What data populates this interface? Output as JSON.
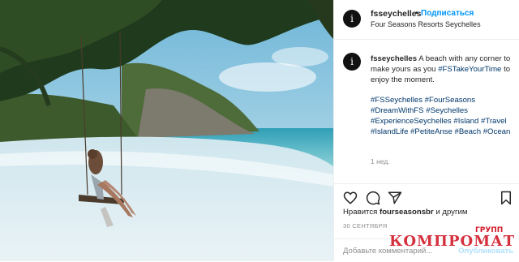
{
  "post": {
    "username": "fsseychelles",
    "separator": "•",
    "follow_label": "Подписаться",
    "location": "Four Seasons Resorts Seychelles",
    "avatar_letter": "i",
    "image_alt": "Woman on swing on a white sand beach with turquoise sea"
  },
  "caption": {
    "username": "fsseychelles",
    "text_1": " A beach with any corner to make yours as you ",
    "tag_1": "#FSTakeYourTime",
    "text_2": " to enjoy the moment.",
    "hashtags": [
      "#FSSeychelles",
      "#FourSeasons",
      "#DreamWithFS",
      "#Seychelles",
      "#ExperienceSeychelles",
      "#Island",
      "#Travel",
      "#IslandLife",
      "#PetiteAnse",
      "#Beach",
      "#Ocean"
    ],
    "time_ago": "1 нед."
  },
  "actions": {
    "icons": [
      "heart-icon",
      "comment-icon",
      "share-icon",
      "bookmark-icon"
    ]
  },
  "likes": {
    "prefix": "Нравится ",
    "user": "fourseasonsbr",
    "suffix": " и другим"
  },
  "date": "30 СЕНТЯБРЯ",
  "comment": {
    "placeholder": "Добавьте комментарий...",
    "publish_label": "Опубликовать"
  },
  "watermark": {
    "main": "КОМПРОМАТ",
    "sup": "ГРУПП"
  },
  "colors": {
    "accent": "#0095f6",
    "hashtag": "#00376b",
    "watermark": "#d11a2a"
  }
}
